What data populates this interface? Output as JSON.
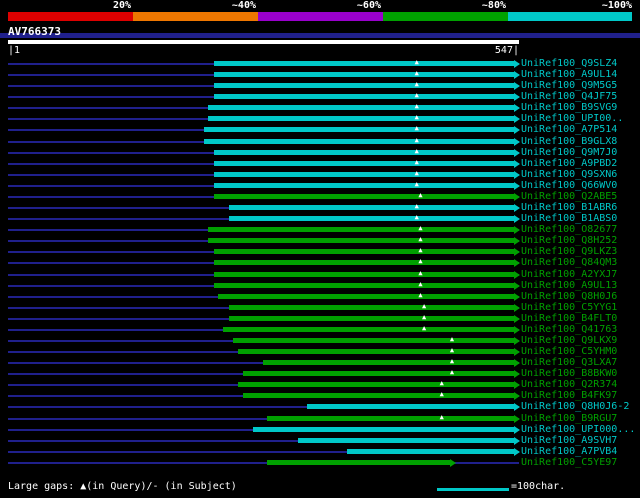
{
  "chart_data": {
    "type": "bar",
    "query_name": "AV766373",
    "query_length": 547,
    "x_range": [
      1,
      547
    ],
    "ruler": {
      "start_label": "|1",
      "end_label": "547|"
    },
    "identity_scale": [
      {
        "label": "20%",
        "color": "#dd0000"
      },
      {
        "label": "~40%",
        "color": "#ee7700"
      },
      {
        "label": "~60%",
        "color": "#9900cc"
      },
      {
        "label": "~80%",
        "color": "#00a000"
      },
      {
        "label": "~100%",
        "color": "#00c8c8"
      }
    ],
    "hits": [
      {
        "label": "UniRef100_Q9SLZ4",
        "color": "cyan",
        "start": 223,
        "end": 547,
        "gaps": [
          443
        ]
      },
      {
        "label": "UniRef100_A9UL14",
        "color": "cyan",
        "start": 223,
        "end": 547,
        "gaps": [
          443
        ]
      },
      {
        "label": "UniRef100_Q9M5G5",
        "color": "cyan",
        "start": 223,
        "end": 547,
        "gaps": [
          443
        ]
      },
      {
        "label": "UniRef100_Q4JF75",
        "color": "cyan",
        "start": 223,
        "end": 547,
        "gaps": [
          443
        ]
      },
      {
        "label": "UniRef100_B9SVG9",
        "color": "cyan",
        "start": 217,
        "end": 547,
        "gaps": [
          443
        ]
      },
      {
        "label": "UniRef100_UPI00..",
        "color": "cyan",
        "start": 217,
        "end": 547,
        "gaps": [
          443
        ]
      },
      {
        "label": "UniRef100_A7P514",
        "color": "cyan",
        "start": 212,
        "end": 547,
        "gaps": [
          443
        ]
      },
      {
        "label": "UniRef100_B9GLX8",
        "color": "cyan",
        "start": 212,
        "end": 547,
        "gaps": [
          443
        ]
      },
      {
        "label": "UniRef100_Q9M7J0",
        "color": "cyan",
        "start": 223,
        "end": 547,
        "gaps": [
          443
        ]
      },
      {
        "label": "UniRef100_A9PBD2",
        "color": "cyan",
        "start": 223,
        "end": 547,
        "gaps": [
          443
        ]
      },
      {
        "label": "UniRef100_Q9SXN6",
        "color": "cyan",
        "start": 223,
        "end": 547,
        "gaps": [
          443
        ]
      },
      {
        "label": "UniRef100_Q66WV0",
        "color": "cyan",
        "start": 223,
        "end": 547,
        "gaps": [
          443
        ]
      },
      {
        "label": "UniRef100_Q2ABE5",
        "color": "green",
        "start": 223,
        "end": 547,
        "gaps": [
          447
        ]
      },
      {
        "label": "UniRef100_B1ABR6",
        "color": "cyan",
        "start": 239,
        "end": 547,
        "gaps": [
          443
        ]
      },
      {
        "label": "UniRef100_B1ABS0",
        "color": "cyan",
        "start": 239,
        "end": 547,
        "gaps": [
          443
        ]
      },
      {
        "label": "UniRef100_O82677",
        "color": "green",
        "start": 217,
        "end": 547,
        "gaps": [
          447
        ]
      },
      {
        "label": "UniRef100_Q8H252",
        "color": "green",
        "start": 217,
        "end": 547,
        "gaps": [
          447
        ]
      },
      {
        "label": "UniRef100_Q9LKZ3",
        "color": "green",
        "start": 223,
        "end": 547,
        "gaps": [
          447
        ]
      },
      {
        "label": "UniRef100_Q84QM3",
        "color": "green",
        "start": 223,
        "end": 547,
        "gaps": [
          447
        ]
      },
      {
        "label": "UniRef100_A2YXJ7",
        "color": "green",
        "start": 223,
        "end": 547,
        "gaps": [
          447
        ]
      },
      {
        "label": "UniRef100_A9UL13",
        "color": "green",
        "start": 223,
        "end": 547,
        "gaps": [
          447
        ]
      },
      {
        "label": "UniRef100_Q8H0J6",
        "color": "green",
        "start": 228,
        "end": 547,
        "gaps": [
          447
        ]
      },
      {
        "label": "UniRef100_C5YYG1",
        "color": "green",
        "start": 239,
        "end": 547,
        "gaps": [
          451
        ]
      },
      {
        "label": "UniRef100_B4FLT0",
        "color": "green",
        "start": 239,
        "end": 547,
        "gaps": [
          451
        ]
      },
      {
        "label": "UniRef100_Q41763",
        "color": "green",
        "start": 233,
        "end": 547,
        "gaps": [
          451
        ]
      },
      {
        "label": "UniRef100_Q9LKX9",
        "color": "green",
        "start": 244,
        "end": 547,
        "gaps": [
          481
        ]
      },
      {
        "label": "UniRef100_C5YHM0",
        "color": "green",
        "start": 249,
        "end": 547,
        "gaps": [
          481
        ]
      },
      {
        "label": "UniRef100_Q3LXA7",
        "color": "green",
        "start": 276,
        "end": 547,
        "gaps": [
          481
        ]
      },
      {
        "label": "UniRef100_B8BKW0",
        "color": "green",
        "start": 255,
        "end": 547,
        "gaps": [
          481
        ]
      },
      {
        "label": "UniRef100_Q2R374",
        "color": "green",
        "start": 249,
        "end": 547,
        "gaps": [
          470
        ]
      },
      {
        "label": "UniRef100_B4FK97",
        "color": "green",
        "start": 255,
        "end": 547,
        "gaps": [
          470
        ]
      },
      {
        "label": "UniRef100_Q8H0J6-2",
        "color": "cyan",
        "start": 324,
        "end": 547,
        "gaps": []
      },
      {
        "label": "UniRef100_B9RGU7",
        "color": "green",
        "start": 281,
        "end": 547,
        "gaps": [
          470
        ]
      },
      {
        "label": "UniRef100_UPI000...",
        "color": "cyan",
        "start": 265,
        "end": 547,
        "gaps": []
      },
      {
        "label": "UniRef100_A9SVH7",
        "color": "cyan",
        "start": 314,
        "end": 547,
        "gaps": []
      },
      {
        "label": "UniRef100_A7PVB4",
        "color": "cyan",
        "start": 367,
        "end": 547,
        "gaps": []
      },
      {
        "label": "UniRef100_C5YE97",
        "color": "green",
        "start": 281,
        "end": 478,
        "gaps": []
      }
    ],
    "legend": {
      "gaps_note": "Large gaps: ▲(in Query)/- (in Subject)",
      "scale_note": "=100char.",
      "scale_chars": 100
    }
  },
  "colors": {
    "background": "#000000",
    "cyan": "#00c8c8",
    "green": "#00a000",
    "track": "#20208c",
    "query_bar": "#ffffff",
    "gap_marker": "#ffffff",
    "text": "#ffffff"
  }
}
